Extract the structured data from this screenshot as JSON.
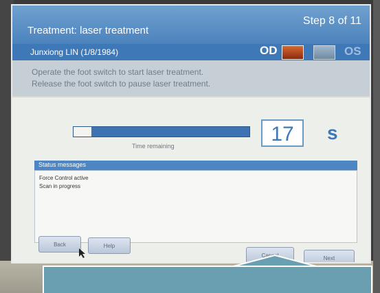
{
  "window": {
    "title": "Treatment: laser treatment",
    "step": "Step 8 of 11"
  },
  "patient": {
    "name": "Junxiong LIN (1/8/1984)",
    "od_label": "OD",
    "os_label": "OS",
    "selected_eye": "OD"
  },
  "instructions": {
    "line1": "Operate the foot switch to start laser treatment.",
    "line2": "Release the foot switch to pause laser treatment."
  },
  "progress": {
    "label": "Time remaining",
    "elapsed_fraction": 0.1
  },
  "timer": {
    "value": "17",
    "unit": "s"
  },
  "status": {
    "header": "Status messages",
    "messages": [
      "Force Control active",
      "Scan in progress"
    ]
  },
  "buttons": {
    "back": "Back",
    "help": "Help",
    "cancel": "Cancel",
    "next": "Next"
  },
  "colors": {
    "title_bar": "#5c92c8",
    "accent": "#3f78b6",
    "banner": "#6a9fb2"
  }
}
